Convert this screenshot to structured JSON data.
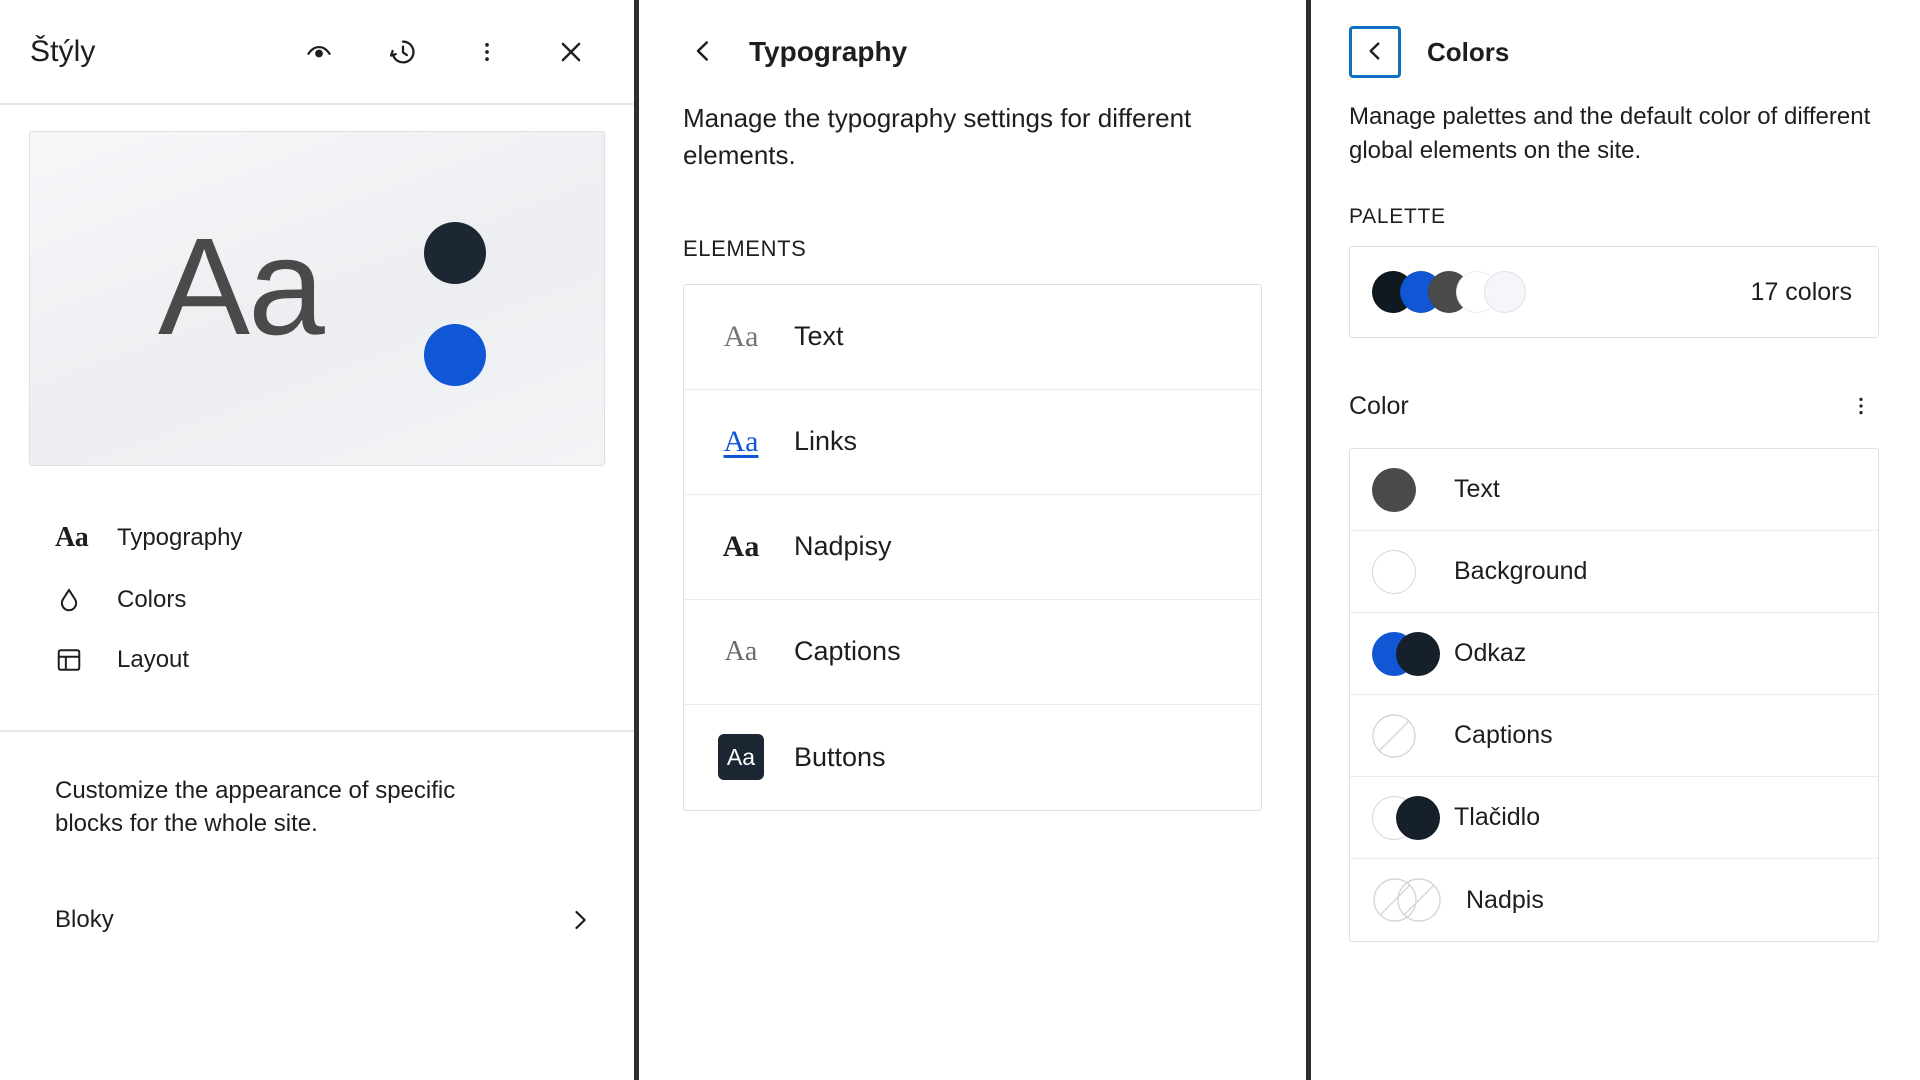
{
  "left_panel": {
    "title": "Štýly",
    "header_tools": [
      {
        "name": "eye-icon",
        "label": "Preview"
      },
      {
        "name": "revisions-icon",
        "label": "Revisions"
      },
      {
        "name": "kebab-menu-icon",
        "label": "More"
      },
      {
        "name": "close-icon",
        "label": "Close"
      }
    ],
    "preview": {
      "sample_text": "Aa",
      "dot_1_color": "#1c2733",
      "dot_2_color": "#1156d4"
    },
    "menu": [
      {
        "icon": "typography-aa-icon",
        "label": "Typography"
      },
      {
        "icon": "droplet-icon",
        "label": "Colors"
      },
      {
        "icon": "layout-grid-icon",
        "label": "Layout"
      }
    ],
    "description": "Customize the appearance of specific blocks for the whole site.",
    "blocks_row": {
      "label": "Bloky",
      "chevron": "chevron-right-icon"
    }
  },
  "middle_panel": {
    "back_label": "Back",
    "title": "Typography",
    "description": "Manage the typography settings for different elements.",
    "section_label": "ELEMENTS",
    "elements": [
      {
        "icon_style": "serif",
        "sample": "Aa",
        "label": "Text"
      },
      {
        "icon_style": "link",
        "sample": "Aa",
        "label": "Links"
      },
      {
        "icon_style": "bold",
        "sample": "Aa",
        "label": "Nadpisy"
      },
      {
        "icon_style": "caption",
        "sample": "Aa",
        "label": "Captions"
      },
      {
        "icon_style": "badge",
        "sample": "Aa",
        "label": "Buttons"
      }
    ]
  },
  "right_panel": {
    "back_label": "Back",
    "title": "Colors",
    "description": "Manage palettes and the default color of different global elements on the site.",
    "palette_section_label": "PALETTE",
    "palette": {
      "count_label": "17 colors",
      "swatches": [
        "#101820",
        "#1156d4",
        "#4a4a4a",
        "#ffffff",
        "#f4f6f9"
      ]
    },
    "color_section": {
      "title": "Color",
      "menu_icon": "kebab-menu-icon"
    },
    "colors": [
      {
        "label": "Text",
        "type": "single",
        "color_1": "#4a4a4a",
        "color_2": null
      },
      {
        "label": "Background",
        "type": "single",
        "color_1": "#ffffff",
        "color_2": null
      },
      {
        "label": "Odkaz",
        "type": "double",
        "color_1": "#1156d4",
        "color_2": "#15202b"
      },
      {
        "label": "Captions",
        "type": "unset",
        "color_1": null,
        "color_2": null
      },
      {
        "label": "Tlačidlo",
        "type": "double",
        "color_1": "#ffffff",
        "color_2": "#15202b"
      },
      {
        "label": "Nadpis",
        "type": "unset2",
        "color_1": null,
        "color_2": null
      }
    ]
  }
}
